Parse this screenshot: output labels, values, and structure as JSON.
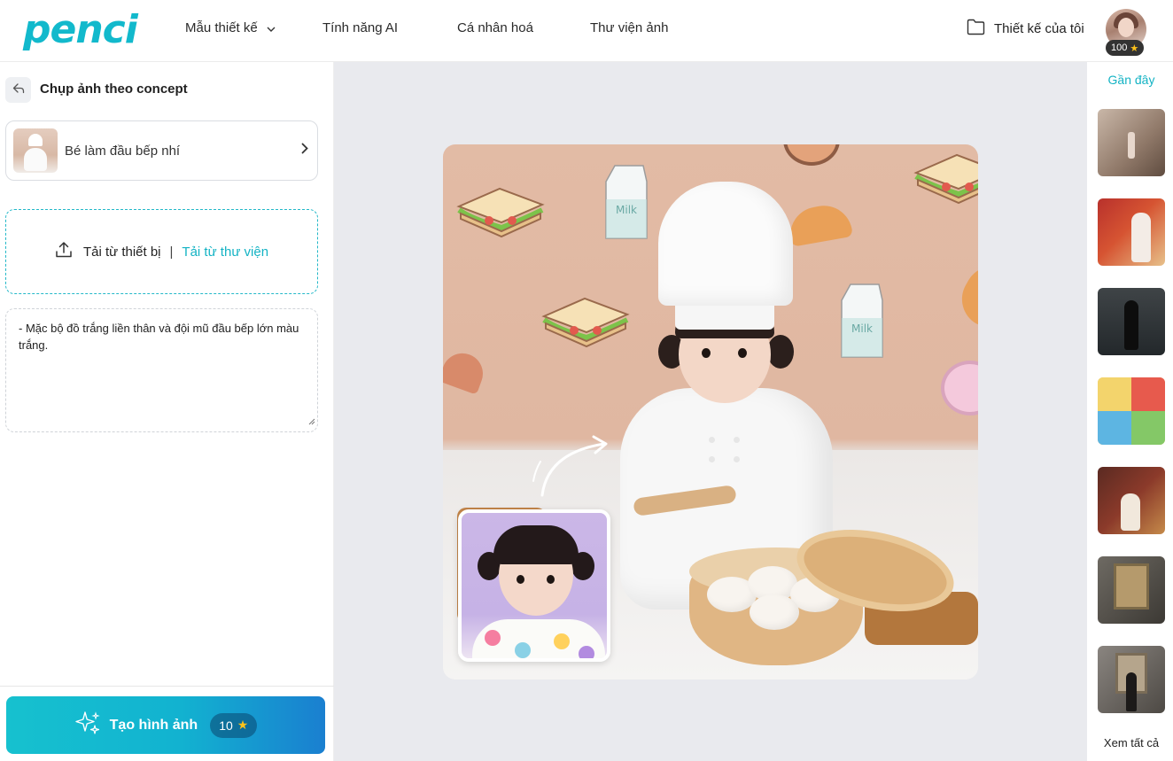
{
  "header": {
    "logo": "penci",
    "nav": [
      {
        "label": "Mẫu thiết kế",
        "has_dropdown": true
      },
      {
        "label": "Tính năng AI",
        "has_dropdown": false
      },
      {
        "label": "Cá nhân hoá",
        "has_dropdown": false
      },
      {
        "label": "Thư viện ảnh",
        "has_dropdown": false
      }
    ],
    "my_designs_label": "Thiết kế của tôi",
    "credits": "100"
  },
  "left_panel": {
    "title": "Chụp ảnh theo concept",
    "concept": {
      "label": "Bé làm đầu bếp nhí"
    },
    "upload": {
      "device_label": "Tải từ thiết bị",
      "separator": "|",
      "library_label": "Tải từ thư viện"
    },
    "prompt_text": "- Mặc bộ đồ trắng liền thân và đội mũ đầu bếp lớn màu trắng.",
    "generate": {
      "label": "Tạo hình ảnh",
      "cost": "10"
    }
  },
  "canvas": {
    "milk_label": "Milk"
  },
  "right_panel": {
    "title": "Gần đây",
    "view_all_label": "Xem tất cả",
    "thumbnails": [
      {
        "name": "recent-1"
      },
      {
        "name": "recent-2"
      },
      {
        "name": "recent-3"
      },
      {
        "name": "recent-4"
      },
      {
        "name": "recent-5"
      },
      {
        "name": "recent-6"
      },
      {
        "name": "recent-7"
      }
    ]
  },
  "colors": {
    "brand": "#12b9cc",
    "accent_text": "#14b3c4",
    "canvas_bg": "#e9eaee",
    "star": "#ffc21a"
  },
  "icons": [
    "chevron-down-icon",
    "folder-icon",
    "star-icon",
    "back-arrow-icon",
    "chevron-right-icon",
    "upload-icon",
    "sparkle-icon",
    "resize-grip-icon"
  ]
}
